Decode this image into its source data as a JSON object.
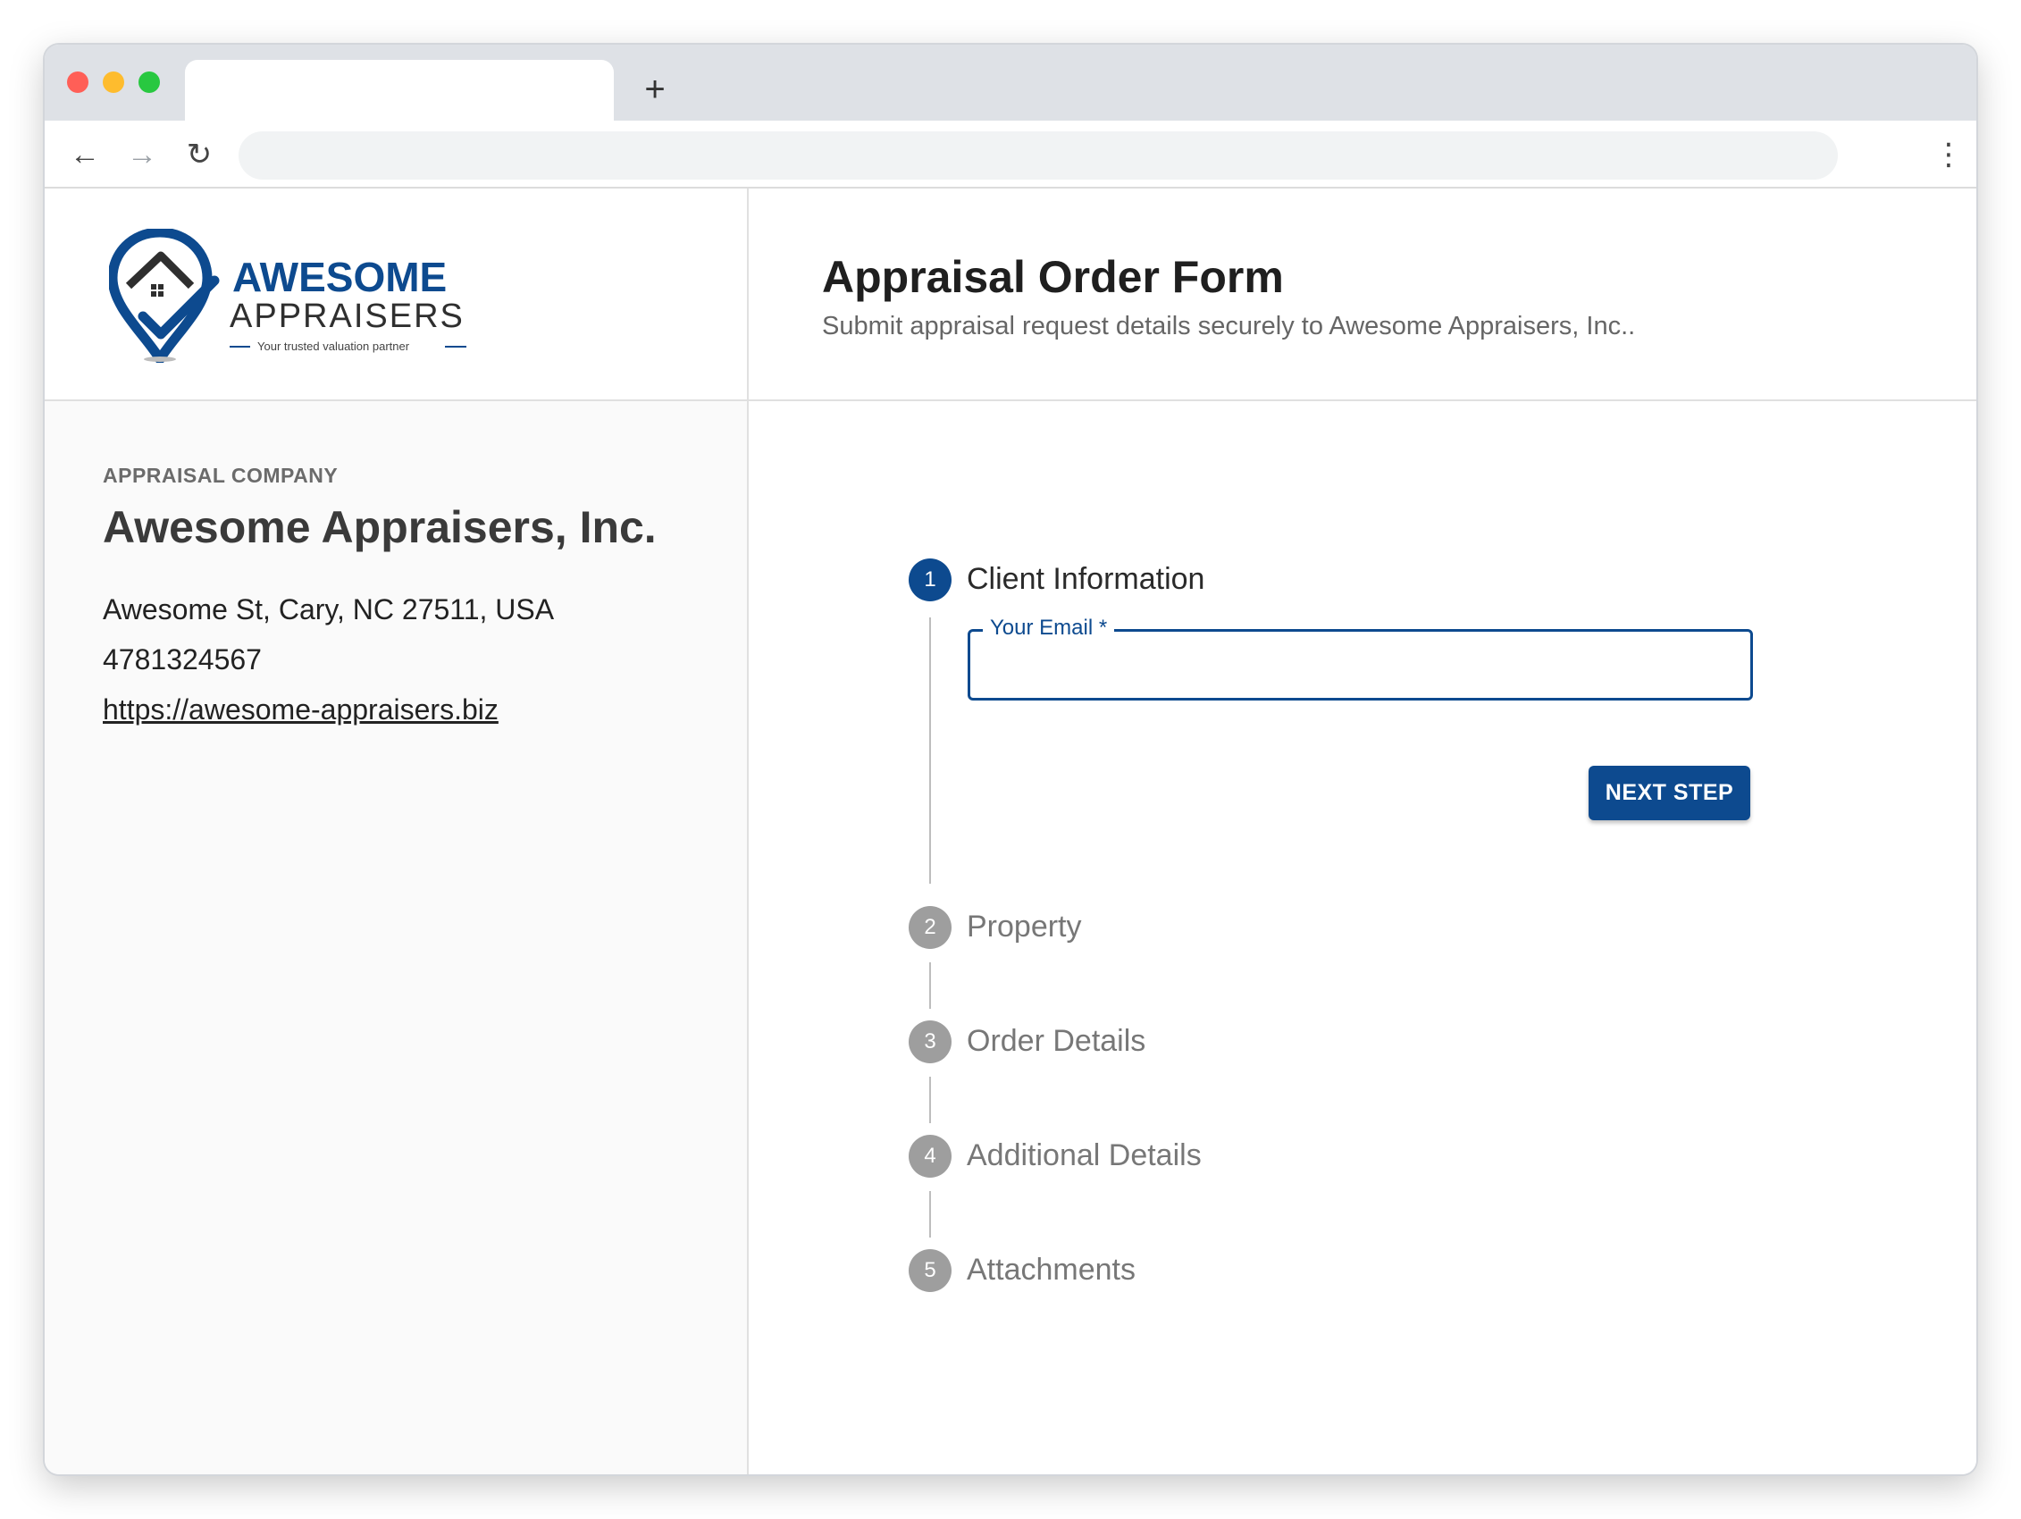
{
  "browser": {
    "new_tab_label": "+",
    "back_icon": "←",
    "forward_icon": "→",
    "reload_icon": "↻",
    "menu_icon": "⋮"
  },
  "logo": {
    "line1": "AWESOME",
    "line2": "APPRAISERS",
    "tagline": "Your trusted valuation partner"
  },
  "company": {
    "label": "APPRAISAL COMPANY",
    "name": "Awesome Appraisers, Inc.",
    "address": "Awesome St, Cary, NC 27511, USA",
    "phone": "4781324567",
    "url": "https://awesome-appraisers.biz"
  },
  "form": {
    "title": "Appraisal Order Form",
    "subtitle": "Submit appraisal request details securely to Awesome Appraisers, Inc..",
    "email_label": "Your Email *",
    "email_value": "",
    "next_label": "NEXT STEP"
  },
  "steps": [
    {
      "number": "1",
      "label": "Client Information",
      "active": true
    },
    {
      "number": "2",
      "label": "Property",
      "active": false
    },
    {
      "number": "3",
      "label": "Order Details",
      "active": false
    },
    {
      "number": "4",
      "label": "Additional Details",
      "active": false
    },
    {
      "number": "5",
      "label": "Attachments",
      "active": false
    }
  ],
  "colors": {
    "brand_blue": "#0d4a8f",
    "inactive_step": "#9e9e9e"
  }
}
